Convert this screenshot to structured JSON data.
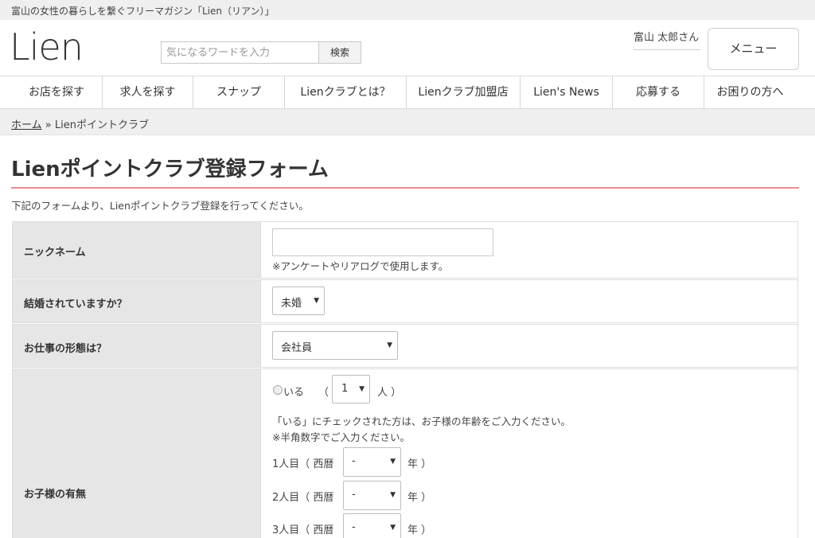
{
  "topbar": {
    "tagline": "富山の女性の暮らしを繋ぐフリーマガジン「Lien（リアン）」"
  },
  "header": {
    "logo": "Lien",
    "search": {
      "placeholder": "気になるワードを入力",
      "button": "検索"
    },
    "user": "富山 太郎さん",
    "menu_button": "メニュー"
  },
  "nav": {
    "items": [
      "お店を探す",
      "求人を探す",
      "スナップ",
      "Lienクラブとは？",
      "Lienクラブ加盟店",
      "Lien's News",
      "応募する",
      "お困りの方へ"
    ]
  },
  "breadcrumb": {
    "home": "ホーム",
    "separator": "»",
    "current": "Lienポイントクラブ"
  },
  "page": {
    "title": "Lienポイントクラブ登録フォーム",
    "intro": "下記のフォームより、Lienポイントクラブ登録を行ってください。"
  },
  "form": {
    "nickname": {
      "label": "ニックネーム",
      "value": "",
      "note": "※アンケートやリアログで使用します。"
    },
    "married": {
      "label": "結婚されていますか？",
      "value": "未婚"
    },
    "job": {
      "label": "お仕事の形態は？",
      "value": "会社員"
    },
    "children": {
      "label": "お子様の有無",
      "radio_label": "いる",
      "paren_open": "（",
      "count_value": "1",
      "count_suffix": "人 ）",
      "note1": "「いる」にチェックされた方は、お子様の年齢をご入力ください。",
      "note2": "※半角数字でご入力ください。",
      "kids": [
        {
          "prefix": "1人目（ 西暦",
          "value": "-",
          "suffix": "年 ）"
        },
        {
          "prefix": "2人目（ 西暦",
          "value": "-",
          "suffix": "年 ）"
        },
        {
          "prefix": "3人目（ 西暦",
          "value": "-",
          "suffix": "年 ）"
        }
      ]
    }
  }
}
